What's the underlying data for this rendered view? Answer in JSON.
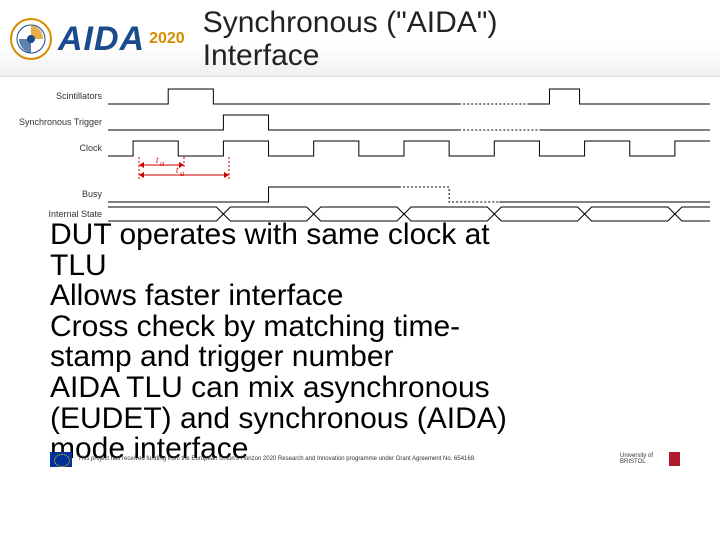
{
  "header": {
    "logo_name": "AIDA",
    "logo_year": "2020",
    "title_line1": "Synchronous (\"AIDA\")",
    "title_line2": "Interface"
  },
  "signals": {
    "s0": "Scintillators",
    "s1": "Synchronous Trigger",
    "s2": "Clock",
    "s3": "Busy",
    "s4": "Internal State"
  },
  "timing_labels": {
    "t_cl": "t_cl",
    "t_sl": "t_sl"
  },
  "body": {
    "l1": "DUT operates with same clock at",
    "l2": "TLU",
    "l3": "Allows faster interface",
    "l4": "Cross check by matching time-",
    "l5": "stamp and trigger number",
    "l6": "AIDA TLU can mix asynchronous",
    "l7": "(EUDET) and synchronous (AIDA)",
    "l8": "mode interface"
  },
  "footer": {
    "funding": "This project has received funding from the European Union's Horizon 2020 Research and Innovation programme under Grant Agreement No. 654168.",
    "university": "University of BRISTOL"
  }
}
